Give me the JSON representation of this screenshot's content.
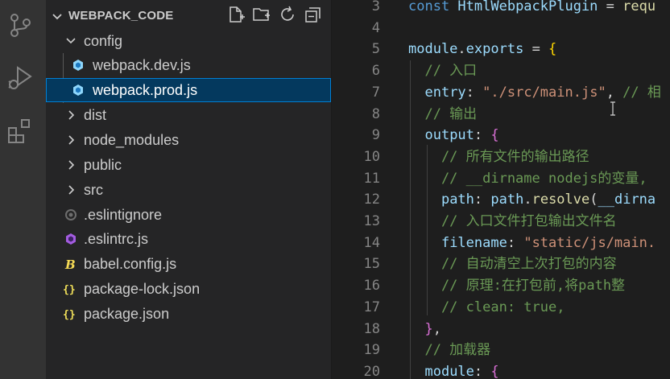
{
  "explorer": {
    "title": "WEBPACK_CODE",
    "actions": [
      "new-file-icon",
      "new-folder-icon",
      "refresh-icon",
      "collapse-all-icon"
    ]
  },
  "tree": [
    {
      "label": "config",
      "type": "folder",
      "expanded": true,
      "depth": 0
    },
    {
      "label": "webpack.dev.js",
      "type": "webpack",
      "depth": 1
    },
    {
      "label": "webpack.prod.js",
      "type": "webpack",
      "depth": 1,
      "selected": true
    },
    {
      "label": "dist",
      "type": "folder",
      "expanded": false,
      "depth": 0
    },
    {
      "label": "node_modules",
      "type": "folder",
      "expanded": false,
      "depth": 0
    },
    {
      "label": "public",
      "type": "folder",
      "expanded": false,
      "depth": 0
    },
    {
      "label": "src",
      "type": "folder",
      "expanded": false,
      "depth": 0
    },
    {
      "label": ".eslintignore",
      "type": "eslintignore",
      "depth": 0
    },
    {
      "label": ".eslintrc.js",
      "type": "eslintrc",
      "depth": 0
    },
    {
      "label": "babel.config.js",
      "type": "babel",
      "depth": 0
    },
    {
      "label": "package-lock.json",
      "type": "json",
      "depth": 0
    },
    {
      "label": "package.json",
      "type": "json",
      "depth": 0
    }
  ],
  "colors": {
    "accent": "#007fd4",
    "keyword": "#569cd6",
    "variable": "#9cdcfe",
    "function": "#dcdcaa",
    "string": "#ce9178",
    "comment": "#6a9955",
    "class": "#4ec9b0",
    "brace": "#ffd700",
    "brace2": "#da70d6"
  },
  "code": [
    {
      "n": "3",
      "tokens": [
        {
          "t": "const ",
          "c": "keyword"
        },
        {
          "t": "HtmlWebpackPlugin",
          "c": "variable"
        },
        {
          "t": " = ",
          "c": "plain"
        },
        {
          "t": "requ",
          "c": "function"
        }
      ]
    },
    {
      "n": "4",
      "tokens": []
    },
    {
      "n": "5",
      "tokens": [
        {
          "t": "module",
          "c": "variable"
        },
        {
          "t": ".",
          "c": "plain"
        },
        {
          "t": "exports",
          "c": "variable"
        },
        {
          "t": " = ",
          "c": "plain"
        },
        {
          "t": "{",
          "c": "brace"
        }
      ]
    },
    {
      "n": "6",
      "tokens": [
        {
          "t": "  // 入口",
          "c": "comment"
        }
      ]
    },
    {
      "n": "7",
      "tokens": [
        {
          "t": "  ",
          "c": "plain"
        },
        {
          "t": "entry",
          "c": "variable"
        },
        {
          "t": ": ",
          "c": "plain"
        },
        {
          "t": "\"./src/main.js\"",
          "c": "string"
        },
        {
          "t": ", ",
          "c": "plain"
        },
        {
          "t": "// 相",
          "c": "comment"
        }
      ]
    },
    {
      "n": "8",
      "tokens": [
        {
          "t": "  // 输出",
          "c": "comment"
        }
      ]
    },
    {
      "n": "9",
      "tokens": [
        {
          "t": "  ",
          "c": "plain"
        },
        {
          "t": "output",
          "c": "variable"
        },
        {
          "t": ": ",
          "c": "plain"
        },
        {
          "t": "{",
          "c": "brace2"
        }
      ]
    },
    {
      "n": "10",
      "tokens": [
        {
          "t": "    // 所有文件的输出路径",
          "c": "comment"
        }
      ]
    },
    {
      "n": "11",
      "tokens": [
        {
          "t": "    // __dirname nodejs的变量,",
          "c": "comment"
        }
      ]
    },
    {
      "n": "12",
      "tokens": [
        {
          "t": "    ",
          "c": "plain"
        },
        {
          "t": "path",
          "c": "variable"
        },
        {
          "t": ": ",
          "c": "plain"
        },
        {
          "t": "path",
          "c": "variable"
        },
        {
          "t": ".",
          "c": "plain"
        },
        {
          "t": "resolve",
          "c": "function"
        },
        {
          "t": "(",
          "c": "plain"
        },
        {
          "t": "__dirna",
          "c": "variable"
        }
      ]
    },
    {
      "n": "13",
      "tokens": [
        {
          "t": "    // 入口文件打包输出文件名",
          "c": "comment"
        }
      ]
    },
    {
      "n": "14",
      "tokens": [
        {
          "t": "    ",
          "c": "plain"
        },
        {
          "t": "filename",
          "c": "variable"
        },
        {
          "t": ": ",
          "c": "plain"
        },
        {
          "t": "\"static/js/main.",
          "c": "string"
        }
      ]
    },
    {
      "n": "15",
      "tokens": [
        {
          "t": "    // 自动清空上次打包的内容",
          "c": "comment"
        }
      ]
    },
    {
      "n": "16",
      "tokens": [
        {
          "t": "    // 原理:在打包前,将path整",
          "c": "comment"
        }
      ]
    },
    {
      "n": "17",
      "tokens": [
        {
          "t": "    // clean: true,",
          "c": "comment"
        }
      ]
    },
    {
      "n": "18",
      "tokens": [
        {
          "t": "  ",
          "c": "plain"
        },
        {
          "t": "}",
          "c": "brace2"
        },
        {
          "t": ",",
          "c": "plain"
        }
      ]
    },
    {
      "n": "19",
      "tokens": [
        {
          "t": "  // 加载器",
          "c": "comment"
        }
      ]
    },
    {
      "n": "20",
      "tokens": [
        {
          "t": "  ",
          "c": "plain"
        },
        {
          "t": "module",
          "c": "variable"
        },
        {
          "t": ": ",
          "c": "plain"
        },
        {
          "t": "{",
          "c": "brace2"
        }
      ]
    }
  ]
}
